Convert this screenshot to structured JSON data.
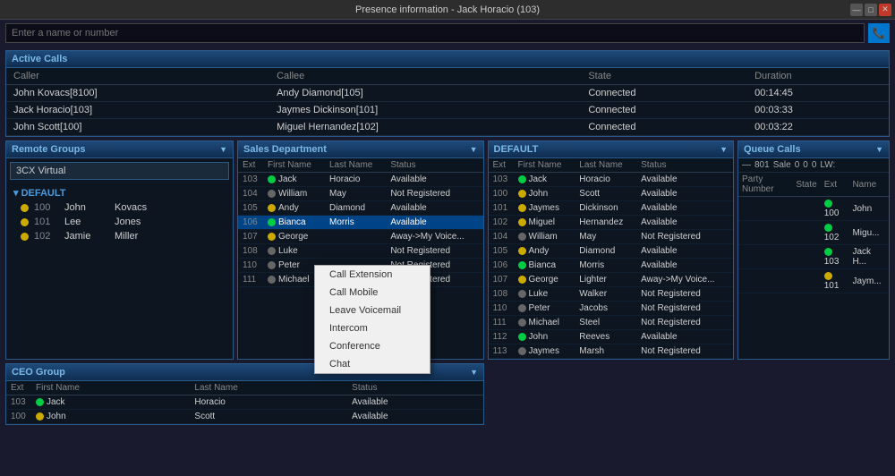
{
  "titleBar": {
    "title": "Presence information - Jack Horacio (103)",
    "controls": [
      "—",
      "□",
      "✕"
    ]
  },
  "searchBar": {
    "placeholder": "Enter a name or number"
  },
  "activeCalls": {
    "label": "Active Calls",
    "columns": [
      "Caller",
      "Callee",
      "State",
      "Duration"
    ],
    "rows": [
      {
        "caller": "John Kovacs[8100]",
        "callee": "Andy Diamond[105]",
        "state": "Connected",
        "duration": "00:14:45"
      },
      {
        "caller": "Jack Horacio[103]",
        "callee": "Jaymes Dickinson[101]",
        "state": "Connected",
        "duration": "00:03:33"
      },
      {
        "caller": "John Scott[100]",
        "callee": "Miguel Hernandez[102]",
        "state": "Connected",
        "duration": "00:03:22"
      }
    ]
  },
  "remoteGroups": {
    "label": "Remote Groups",
    "selectOptions": [
      "3CX Virtual"
    ],
    "selectedOption": "3CX Virtual",
    "treeGroupLabel": "DEFAULT",
    "items": [
      {
        "ext": "100",
        "first": "John",
        "last": "Kovacs",
        "status": "yellow"
      },
      {
        "ext": "101",
        "first": "Lee",
        "last": "Jones",
        "status": "yellow"
      },
      {
        "ext": "102",
        "first": "Jamie",
        "last": "Miller",
        "status": "yellow"
      }
    ]
  },
  "salesDept": {
    "label": "Sales Department",
    "columns": [
      "Ext",
      "First Name",
      "Last Name",
      "Status"
    ],
    "rows": [
      {
        "ext": "103",
        "first": "Jack",
        "last": "Horacio",
        "status": "Available",
        "dot": "green"
      },
      {
        "ext": "104",
        "first": "William",
        "last": "May",
        "status": "Not Registered",
        "dot": "gray"
      },
      {
        "ext": "105",
        "first": "Andy",
        "last": "Diamond",
        "status": "Available",
        "dot": "yellow"
      },
      {
        "ext": "106",
        "first": "Bianca",
        "last": "Morris",
        "status": "Available",
        "dot": "green",
        "highlighted": true
      },
      {
        "ext": "107",
        "first": "George",
        "last": "",
        "status": "Away->My Voice...",
        "dot": "yellow"
      },
      {
        "ext": "108",
        "first": "Luke",
        "last": "",
        "status": "Not Registered",
        "dot": "gray"
      },
      {
        "ext": "110",
        "first": "Peter",
        "last": "",
        "status": "Not Registered",
        "dot": "gray"
      },
      {
        "ext": "111",
        "first": "Michael",
        "last": "",
        "status": "Not Registered",
        "dot": "gray"
      }
    ]
  },
  "contextMenu": {
    "items": [
      "Call Extension",
      "Call Mobile",
      "Leave Voicemail",
      "Intercom",
      "Conference",
      "Chat"
    ]
  },
  "defaultGroup": {
    "label": "DEFAULT",
    "columns": [
      "Ext",
      "First Name",
      "Last Name",
      "Status"
    ],
    "rows": [
      {
        "ext": "103",
        "first": "Jack",
        "last": "Horacio",
        "status": "Available",
        "dot": "green"
      },
      {
        "ext": "100",
        "first": "John",
        "last": "Scott",
        "status": "Available",
        "dot": "yellow"
      },
      {
        "ext": "101",
        "first": "Jaymes",
        "last": "Dickinson",
        "status": "Available",
        "dot": "yellow"
      },
      {
        "ext": "102",
        "first": "Miguel",
        "last": "Hernandez",
        "status": "Available",
        "dot": "yellow"
      },
      {
        "ext": "104",
        "first": "William",
        "last": "May",
        "status": "Not Registered",
        "dot": "gray"
      },
      {
        "ext": "105",
        "first": "Andy",
        "last": "Diamond",
        "status": "Available",
        "dot": "yellow"
      },
      {
        "ext": "106",
        "first": "Bianca",
        "last": "Morris",
        "status": "Available",
        "dot": "green"
      },
      {
        "ext": "107",
        "first": "George",
        "last": "Lighter",
        "status": "Away->My Voice...",
        "dot": "yellow"
      },
      {
        "ext": "108",
        "first": "Luke",
        "last": "Walker",
        "status": "Not Registered",
        "dot": "gray"
      },
      {
        "ext": "110",
        "first": "Peter",
        "last": "Jacobs",
        "status": "Not Registered",
        "dot": "gray"
      },
      {
        "ext": "111",
        "first": "Michael",
        "last": "Steel",
        "status": "Not Registered",
        "dot": "gray"
      },
      {
        "ext": "112",
        "first": "John",
        "last": "Reeves",
        "status": "Available",
        "dot": "green"
      },
      {
        "ext": "113",
        "first": "Jaymes",
        "last": "Marsh",
        "status": "Not Registered",
        "dot": "gray"
      }
    ]
  },
  "queueCalls": {
    "label": "Queue Calls",
    "stats": {
      "queueId": "801",
      "salLabel": "Sale",
      "val1": "0",
      "val2": "0",
      "val3": "0",
      "lwLabel": "LW:"
    },
    "columns": [
      "Party Number",
      "State",
      "Ext",
      "Name"
    ],
    "rows": [
      {
        "party": "",
        "state": "",
        "ext": "100",
        "name": "John",
        "dot": "green"
      },
      {
        "party": "",
        "state": "",
        "ext": "102",
        "name": "Migu...",
        "dot": "green"
      },
      {
        "party": "",
        "state": "",
        "ext": "103",
        "name": "Jack H...",
        "dot": "green"
      },
      {
        "party": "",
        "state": "",
        "ext": "101",
        "name": "Jaym...",
        "dot": "yellow"
      }
    ]
  },
  "ceoGroup": {
    "label": "CEO Group",
    "columns": [
      "Ext",
      "First Name",
      "Last Name",
      "Status"
    ],
    "rows": [
      {
        "ext": "103",
        "first": "Jack",
        "last": "Horacio",
        "status": "Available",
        "dot": "green"
      },
      {
        "ext": "100",
        "first": "John",
        "last": "Scott",
        "status": "Available",
        "dot": "yellow"
      }
    ]
  }
}
